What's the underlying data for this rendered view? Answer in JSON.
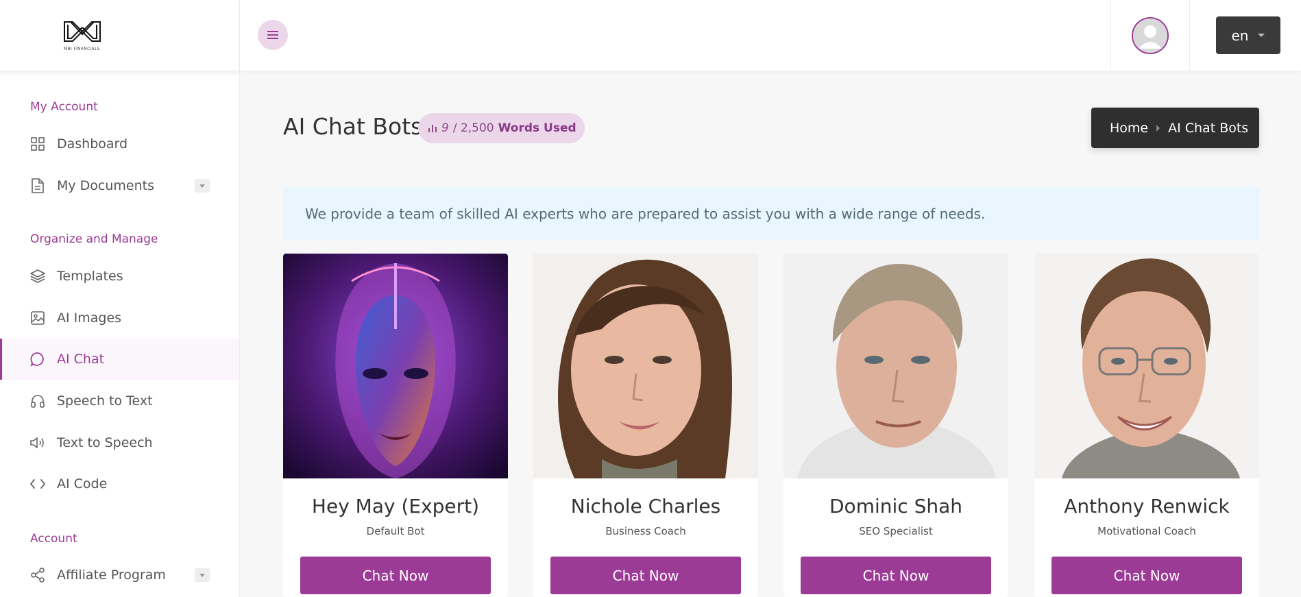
{
  "brand": {
    "logo_text": "MBI FINANCIALS"
  },
  "sidebar": {
    "sections": [
      {
        "title": "My Account"
      },
      {
        "title": "Organize and Manage"
      },
      {
        "title": "Account"
      }
    ],
    "items": [
      {
        "label": "Dashboard",
        "icon": "grid-icon"
      },
      {
        "label": "My Documents",
        "icon": "document-icon",
        "expandable": true
      },
      {
        "label": "Templates",
        "icon": "layers-icon"
      },
      {
        "label": "AI Images",
        "icon": "image-icon"
      },
      {
        "label": "AI Chat",
        "icon": "chat-bubble-icon",
        "active": true
      },
      {
        "label": "Speech to Text",
        "icon": "headphones-icon"
      },
      {
        "label": "Text to Speech",
        "icon": "speaker-icon"
      },
      {
        "label": "AI Code",
        "icon": "code-icon"
      },
      {
        "label": "Affiliate Program",
        "icon": "share-icon",
        "expandable": true
      }
    ]
  },
  "topbar": {
    "language": "en"
  },
  "main": {
    "title": "AI Chat Bots",
    "words_used": {
      "used": "9",
      "separator": "/ 2,500",
      "label": "Words Used"
    },
    "breadcrumb": {
      "home": "Home",
      "current": "AI Chat Bots"
    },
    "info": "We provide a team of skilled AI experts who are prepared to assist you with a wide range of needs."
  },
  "bots": [
    {
      "name": "Hey May (Expert)",
      "role": "Default Bot",
      "button": "Chat Now"
    },
    {
      "name": "Nichole Charles",
      "role": "Business Coach",
      "button": "Chat Now"
    },
    {
      "name": "Dominic Shah",
      "role": "SEO Specialist",
      "button": "Chat Now"
    },
    {
      "name": "Anthony Renwick",
      "role": "Motivational Coach",
      "button": "Chat Now"
    }
  ],
  "colors": {
    "accent": "#9b3b95",
    "accent_light": "#ecd6ea",
    "dark": "#2f2f2f",
    "info_bg": "#e9f6fd"
  }
}
